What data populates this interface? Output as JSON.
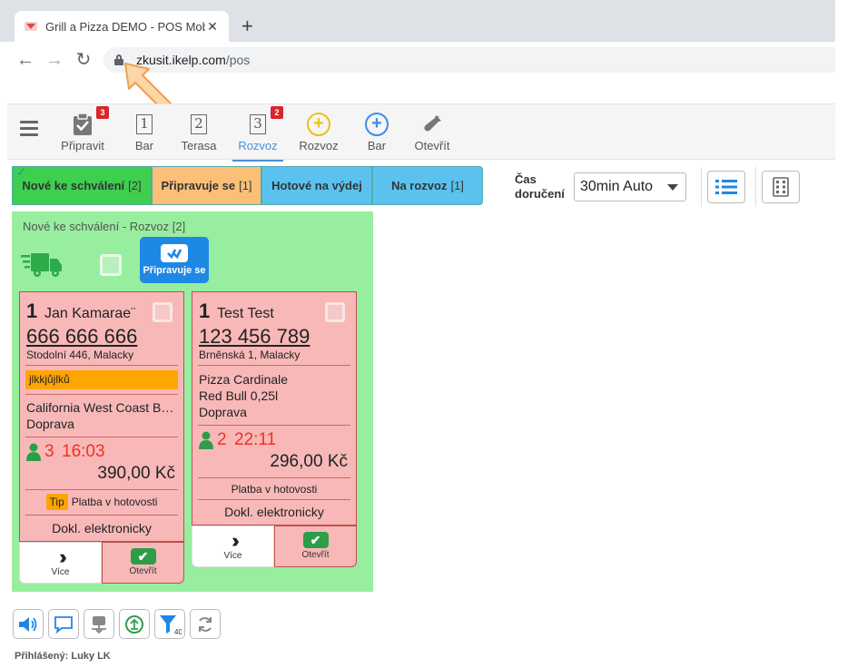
{
  "browser": {
    "tab_title": "Grill a Pizza DEMO - POS Mobile",
    "tab_close": "✕",
    "new_tab": "+",
    "url_host": "zkusit.ikelp.com",
    "url_path": "/pos",
    "back": "←",
    "forward": "→",
    "reload": "↻"
  },
  "nav": {
    "items": [
      {
        "label": "Připravit",
        "badge": "3"
      },
      {
        "label": "Bar",
        "digit": "1"
      },
      {
        "label": "Terasa",
        "digit": "2"
      },
      {
        "label": "Rozvoz",
        "digit": "3",
        "badge": "2"
      },
      {
        "label": "Rozvoz",
        "icon": "+"
      },
      {
        "label": "Bar",
        "icon": "+"
      },
      {
        "label": "Otevřít"
      }
    ]
  },
  "status_tabs": [
    {
      "label": "Nové ke schválení",
      "count": "[2]",
      "color": "#3ecf4f"
    },
    {
      "label": "Připravuje se",
      "count": "[1]",
      "color": "#fbbf78"
    },
    {
      "label": "Hotové na výdej",
      "count": "",
      "color": "#5bc2f0"
    },
    {
      "label": "Na rozvoz",
      "count": "[1]",
      "color": "#5bc2f0"
    }
  ],
  "check_glyph": "✓",
  "delivery": {
    "label_line1": "Čas",
    "label_line2": "doručení",
    "selected": "30min Auto"
  },
  "panel": {
    "title": "Nové ke schválení - Rozvoz [2]",
    "action_label": "Připravuje se"
  },
  "orders": [
    {
      "num": "1",
      "name": "Jan Kamarae¨",
      "phone": "666 666 666",
      "address": "Stodolní 446, Malacky",
      "note": "jlkkjůjlků",
      "items": [
        "California West Coast B…",
        "Doprava"
      ],
      "persons": "3",
      "time": "16:03",
      "price": "390,00 Kč",
      "tip": "Tip",
      "payment": "Platba v hotovosti",
      "doc": "Dokl. elektronicky",
      "more_label": "Více",
      "open_label": "Otevřít"
    },
    {
      "num": "1",
      "name": "Test Test",
      "phone": "123 456 789",
      "address": "Brněnská 1, Malacky",
      "items": [
        "Pizza Cardinale",
        "Red Bull 0,25l",
        "Doprava"
      ],
      "persons": "2",
      "time": "22:11",
      "price": "296,00 Kč",
      "payment": "Platba v hotovosti",
      "doc": "Dokl. elektronicky",
      "more_label": "Více",
      "open_label": "Otevřít"
    }
  ],
  "toolbar": {
    "filter_count": "40"
  },
  "footer": {
    "logged_in": "Přihlášený: Luky LK"
  },
  "colors": {
    "panel_bg": "#98ee9f",
    "card_bg": "#f8b8b8",
    "accent_blue": "#1e88e5",
    "badge_red": "#d9262c",
    "note_orange": "#ffa500",
    "time_red": "#ee3322"
  }
}
